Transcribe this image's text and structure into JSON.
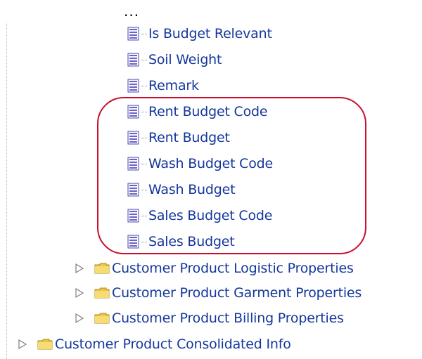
{
  "tree": {
    "ellipsis": "...",
    "attributes": [
      {
        "label": "Is Budget Relevant",
        "icon": "attribute-icon"
      },
      {
        "label": "Soil Weight",
        "icon": "attribute-icon"
      },
      {
        "label": "Remark",
        "icon": "attribute-icon"
      },
      {
        "label": "Rent Budget Code",
        "icon": "attribute-icon"
      },
      {
        "label": "Rent Budget",
        "icon": "attribute-icon"
      },
      {
        "label": "Wash Budget Code",
        "icon": "attribute-icon"
      },
      {
        "label": "Wash Budget",
        "icon": "attribute-icon"
      },
      {
        "label": "Sales Budget Code",
        "icon": "attribute-icon"
      },
      {
        "label": "Sales Budget",
        "icon": "attribute-icon"
      }
    ],
    "folders": [
      {
        "label": "Customer Product Logistic Properties",
        "icon": "folder-icon",
        "expander": "collapsed-triangle-icon"
      },
      {
        "label": "Customer Product Garment Properties",
        "icon": "folder-icon",
        "expander": "collapsed-triangle-icon"
      },
      {
        "label": "Customer Product Billing Properties",
        "icon": "folder-icon",
        "expander": "collapsed-triangle-icon"
      },
      {
        "label": "Customer Product Consolidated Info",
        "icon": "folder-icon",
        "expander": "collapsed-triangle-icon"
      }
    ]
  },
  "colors": {
    "label": "#14379c",
    "highlight": "#c8102e",
    "attribute_icon": "#5d55b5",
    "folder": "#e7c64c",
    "expander": "#7f7f7f"
  }
}
